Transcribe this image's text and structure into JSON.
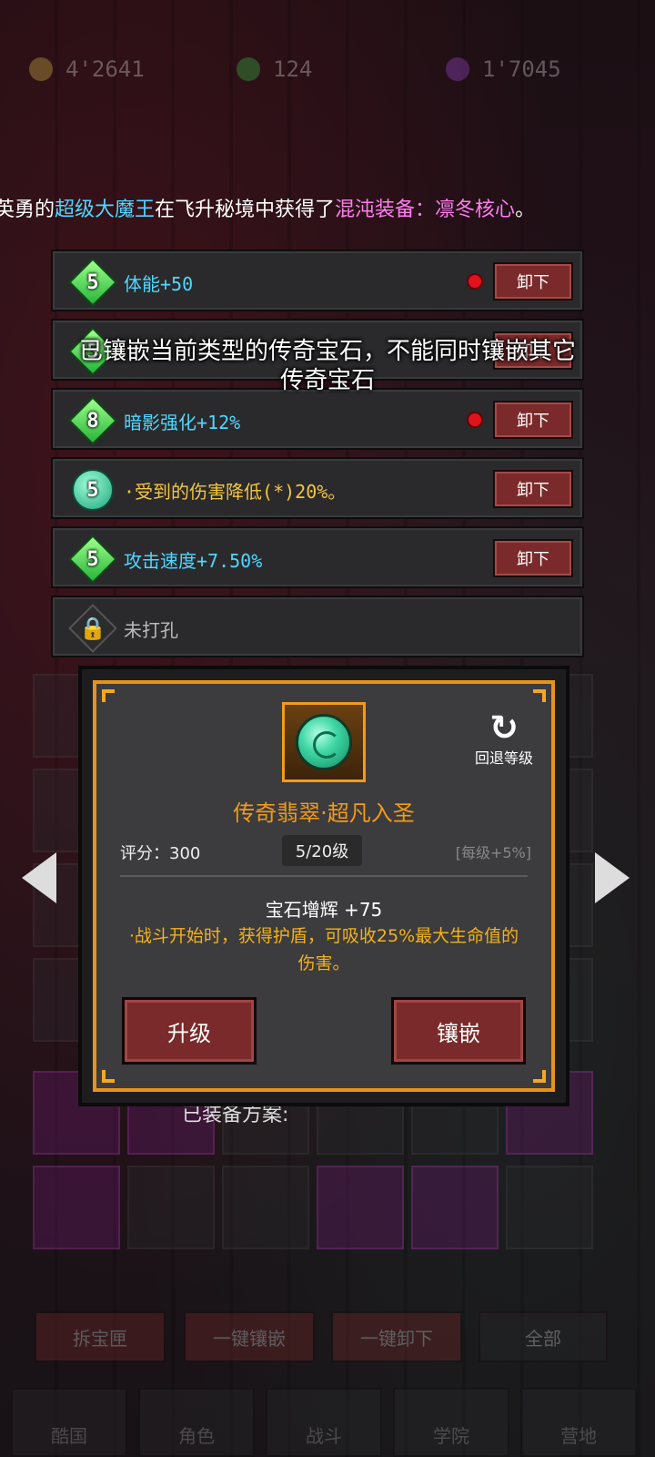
{
  "currency": {
    "gold": {
      "value": "4'2641",
      "color": "#d8b84a",
      "icon": "gold-coin-icon"
    },
    "jade": {
      "value": "124",
      "color": "#35c24a",
      "icon": "green-gem-icon"
    },
    "essence": {
      "value": "1'7045",
      "color": "#a04adb",
      "icon": "purple-drop-icon"
    }
  },
  "ticker": {
    "prefix": "英勇的",
    "player": "超级大魔王",
    "middle": "在飞升秘境中获得了",
    "item": "混沌装备：凛冬核心",
    "suffix": "。"
  },
  "toast": "已镶嵌当前类型的传奇宝石，不能同时镶嵌其它传奇宝石",
  "slots": [
    {
      "level": "5",
      "shape": "diamond",
      "label": "体能+50",
      "red_dot": true,
      "button": "卸下",
      "color": "cyan"
    },
    {
      "level": "5",
      "shape": "diamond",
      "label": "",
      "red_dot": false,
      "button": "卸下",
      "color": "cyan"
    },
    {
      "level": "8",
      "shape": "diamond",
      "label": "暗影强化+12%",
      "red_dot": true,
      "button": "卸下",
      "color": "cyan"
    },
    {
      "level": "5",
      "shape": "circle",
      "label": "·受到的伤害降低(*)20%。",
      "red_dot": false,
      "button": "卸下",
      "color": "gold"
    },
    {
      "level": "5",
      "shape": "diamond",
      "label": "攻击速度+7.50%",
      "red_dot": false,
      "button": "卸下",
      "color": "cyan"
    },
    {
      "level": "",
      "shape": "lock",
      "label": "未打孔",
      "red_dot": false,
      "button": "",
      "color": "grey"
    }
  ],
  "detail": {
    "rollback_label": "回退等级",
    "title": "传奇翡翠·超凡入圣",
    "score": "评分：300",
    "level": "5/20级",
    "per_level": "[每级+5%]",
    "boost": "宝石增辉 +75",
    "effect": "·战斗开始时，获得护盾，可吸收25%最大生命值的伤害。",
    "upgrade_button": "升级",
    "inlay_button": "镶嵌"
  },
  "equipped_label": "已装备方案:",
  "bottom_buttons": [
    "拆宝匣",
    "一键镶嵌",
    "一键卸下",
    "全部"
  ],
  "nav": [
    "酷国",
    "角色",
    "战斗",
    "学院",
    "营地"
  ]
}
